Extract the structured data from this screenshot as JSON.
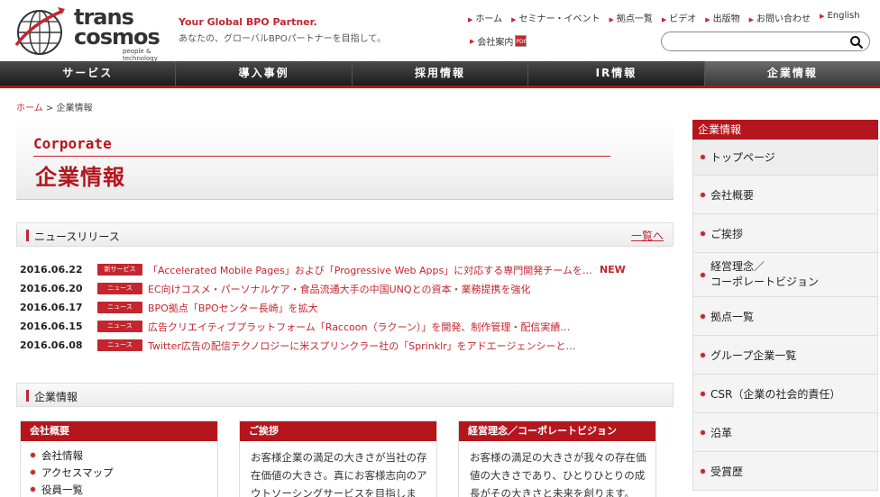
{
  "brand": {
    "logo_line1": "trans",
    "logo_line2": "cosmos",
    "logo_sub": "people & technology",
    "tagline_en": "Your Global BPO Partner.",
    "tagline_ja": "あなたの、グローバルBPOパートナーを目指して。"
  },
  "util_nav": [
    "ホーム",
    "セミナー・イベント",
    "拠点一覧",
    "ビデオ",
    "出版物",
    "お問い合わせ",
    "English"
  ],
  "corporate_guide": {
    "label": "会社案内",
    "badge": "PDF"
  },
  "search": {
    "placeholder": ""
  },
  "global_nav": [
    "サービス",
    "導入事例",
    "採用情報",
    "IR情報",
    "企業情報"
  ],
  "breadcrumb": {
    "home": "ホーム",
    "sep": ">",
    "current": "企業情報"
  },
  "hero": {
    "en": "Corporate",
    "ja": "企業情報"
  },
  "news_section": {
    "title": "ニュースリリース",
    "more": "一覧へ"
  },
  "news": [
    {
      "date": "2016.06.22",
      "tag": "新サービス",
      "title": "「Accelerated Mobile Pages」および「Progressive Web Apps」に対応する専門開発チームを…",
      "new": "NEW"
    },
    {
      "date": "2016.06.20",
      "tag": "ニュース",
      "title": "EC向けコスメ・パーソナルケア・食品流通大手の中国UNQとの資本・業務提携を強化",
      "new": ""
    },
    {
      "date": "2016.06.17",
      "tag": "ニュース",
      "title": "BPO拠点「BPOセンター長崎」を拡大",
      "new": ""
    },
    {
      "date": "2016.06.15",
      "tag": "ニュース",
      "title": "広告クリエイティブプラットフォーム「Raccoon（ラクーン）」を開発、制作管理・配信実績…",
      "new": ""
    },
    {
      "date": "2016.06.08",
      "tag": "ニュース",
      "title": "Twitter広告の配信テクノロジーに米スプリンクラー社の「Sprinklr」をアドエージェンシーと…",
      "new": ""
    }
  ],
  "corp_section": {
    "title": "企業情報"
  },
  "cards": {
    "overview": {
      "title": "会社概要",
      "links": [
        "会社情報",
        "アクセスマップ",
        "役員一覧"
      ]
    },
    "greeting": {
      "title": "ご挨拶",
      "text": "お客様企業の満足の大きさが当社の存在価値の大きさ。真にお客様志向のアウトソーシングサービスを目指しま"
    },
    "philosophy": {
      "title": "経営理念／コーポレートビジョン",
      "text": "お客様の満足の大きさが我々の存在価値の大きさであり、ひとりひとりの成長がその大きさと未来を創ります。"
    }
  },
  "side_nav": {
    "title": "企業情報",
    "items": [
      "トップページ",
      "会社概要",
      "ご挨拶",
      "経営理念／\nコーポレートビジョン",
      "拠点一覧",
      "グループ企業一覧",
      "CSR（企業の社会的責任）",
      "沿革",
      "受賞歴"
    ]
  },
  "colors": {
    "accent": "#c3262e",
    "nav_bg": "#2c2c2c"
  }
}
